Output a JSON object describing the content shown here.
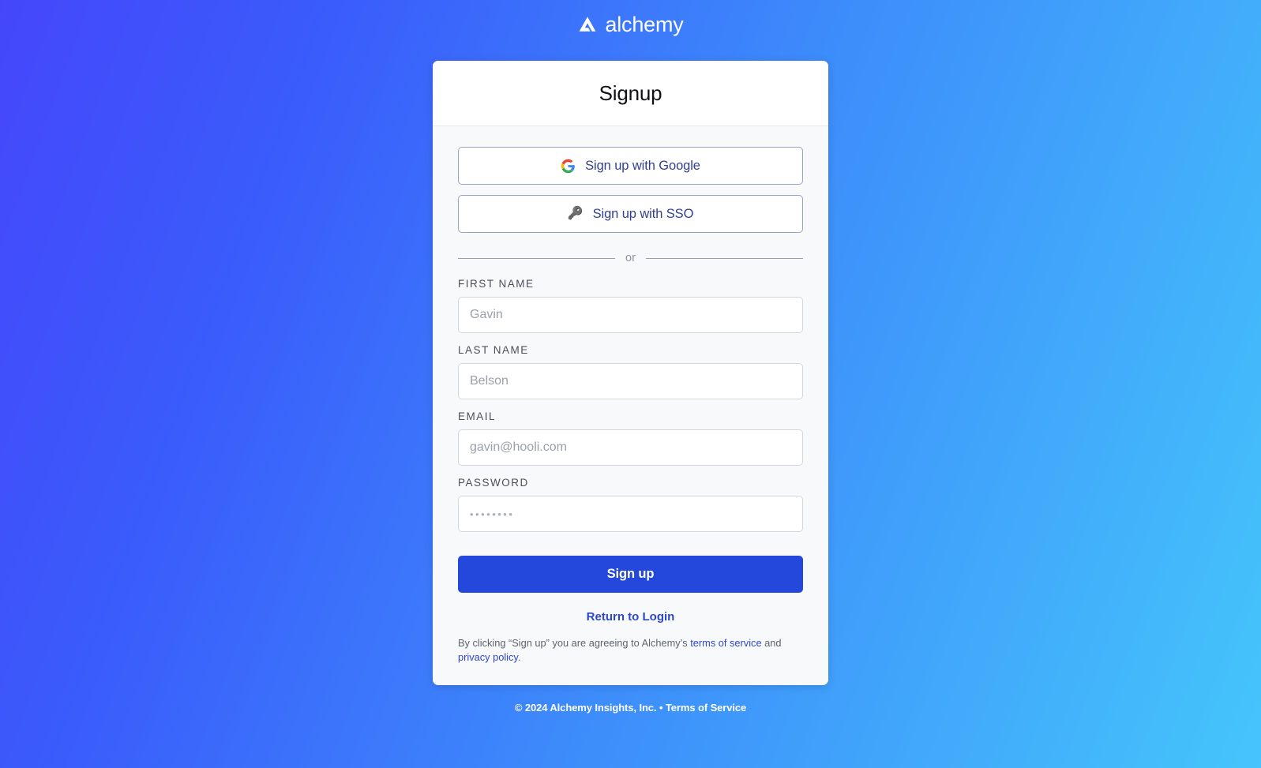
{
  "brand": {
    "logo_icon": "alchemy-triangle-logo",
    "name": "alchemy"
  },
  "card": {
    "title": "Signup",
    "oauth": [
      {
        "icon": "google-icon",
        "label": "Sign up with Google"
      },
      {
        "icon": "key-icon",
        "glyph": "🔑",
        "label": "Sign up with SSO"
      }
    ],
    "divider_text": "or",
    "fields": [
      {
        "label": "FIRST NAME",
        "placeholder": "Gavin",
        "value": "",
        "type": "text"
      },
      {
        "label": "LAST NAME",
        "placeholder": "Belson",
        "value": "",
        "type": "text"
      },
      {
        "label": "EMAIL",
        "placeholder": "gavin@hooli.com",
        "value": "",
        "type": "email"
      },
      {
        "label": "PASSWORD",
        "placeholder": "••••••••",
        "value": "",
        "type": "password"
      }
    ],
    "submit_label": "Sign up",
    "return_link": "Return to Login",
    "legal": {
      "prefix": "By clicking “Sign up” you are agreeing to Alchemy’s ",
      "terms_link": "terms of service",
      "conjunction": " and ",
      "privacy_link": "privacy policy",
      "suffix": "."
    }
  },
  "footer": {
    "copyright": "© 2024 Alchemy Insights, Inc. • ",
    "terms_label": "Terms of Service"
  },
  "colors": {
    "accent": "#2447dc",
    "link": "#2d47c8",
    "oauth_text": "#31418e",
    "bg_start": "#4547fb",
    "bg_end": "#45c5fb"
  }
}
